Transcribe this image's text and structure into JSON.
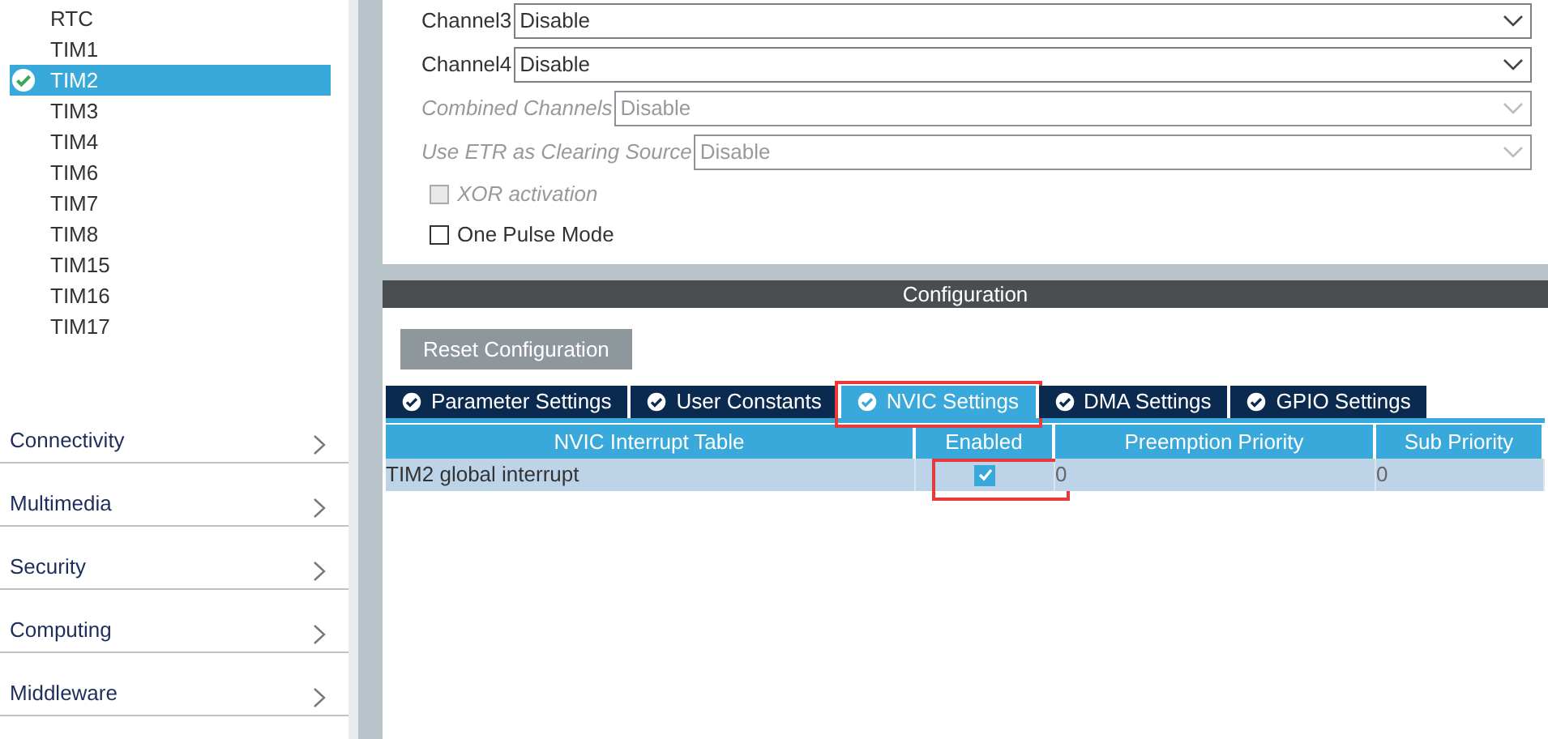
{
  "sidebar": {
    "peripherals": [
      {
        "label": "RTC",
        "selected": false,
        "configured": false
      },
      {
        "label": "TIM1",
        "selected": false,
        "configured": false
      },
      {
        "label": "TIM2",
        "selected": true,
        "configured": true
      },
      {
        "label": "TIM3",
        "selected": false,
        "configured": false
      },
      {
        "label": "TIM4",
        "selected": false,
        "configured": false
      },
      {
        "label": "TIM6",
        "selected": false,
        "configured": false
      },
      {
        "label": "TIM7",
        "selected": false,
        "configured": false
      },
      {
        "label": "TIM8",
        "selected": false,
        "configured": false
      },
      {
        "label": "TIM15",
        "selected": false,
        "configured": false
      },
      {
        "label": "TIM16",
        "selected": false,
        "configured": false
      },
      {
        "label": "TIM17",
        "selected": false,
        "configured": false
      }
    ],
    "categories": [
      {
        "label": "Connectivity"
      },
      {
        "label": "Multimedia"
      },
      {
        "label": "Security"
      },
      {
        "label": "Computing"
      },
      {
        "label": "Middleware"
      }
    ]
  },
  "settings": {
    "fields": [
      {
        "label": "Channel3",
        "value": "Disable",
        "disabled": false
      },
      {
        "label": "Channel4",
        "value": "Disable",
        "disabled": false
      },
      {
        "label": "Combined Channels",
        "value": "Disable",
        "disabled": true
      },
      {
        "label": "Use ETR as Clearing Source",
        "value": "Disable",
        "disabled": true
      }
    ],
    "checkboxes": [
      {
        "label": "XOR activation",
        "checked": false,
        "disabled": true
      },
      {
        "label": "One Pulse Mode",
        "checked": false,
        "disabled": false
      }
    ]
  },
  "configuration": {
    "title": "Configuration",
    "reset_button": "Reset Configuration",
    "tabs": [
      {
        "label": "Parameter Settings",
        "selected": false,
        "highlighted": false
      },
      {
        "label": "User Constants",
        "selected": false,
        "highlighted": false
      },
      {
        "label": "NVIC Settings",
        "selected": true,
        "highlighted": true
      },
      {
        "label": "DMA Settings",
        "selected": false,
        "highlighted": false
      },
      {
        "label": "GPIO Settings",
        "selected": false,
        "highlighted": false
      }
    ],
    "table": {
      "columns": [
        "NVIC Interrupt Table",
        "Enabled",
        "Preemption Priority",
        "Sub Priority"
      ],
      "rows": [
        {
          "name": "TIM2 global interrupt",
          "enabled": true,
          "enabled_highlighted": true,
          "preemption_priority": "0",
          "sub_priority": "0"
        }
      ]
    }
  }
}
